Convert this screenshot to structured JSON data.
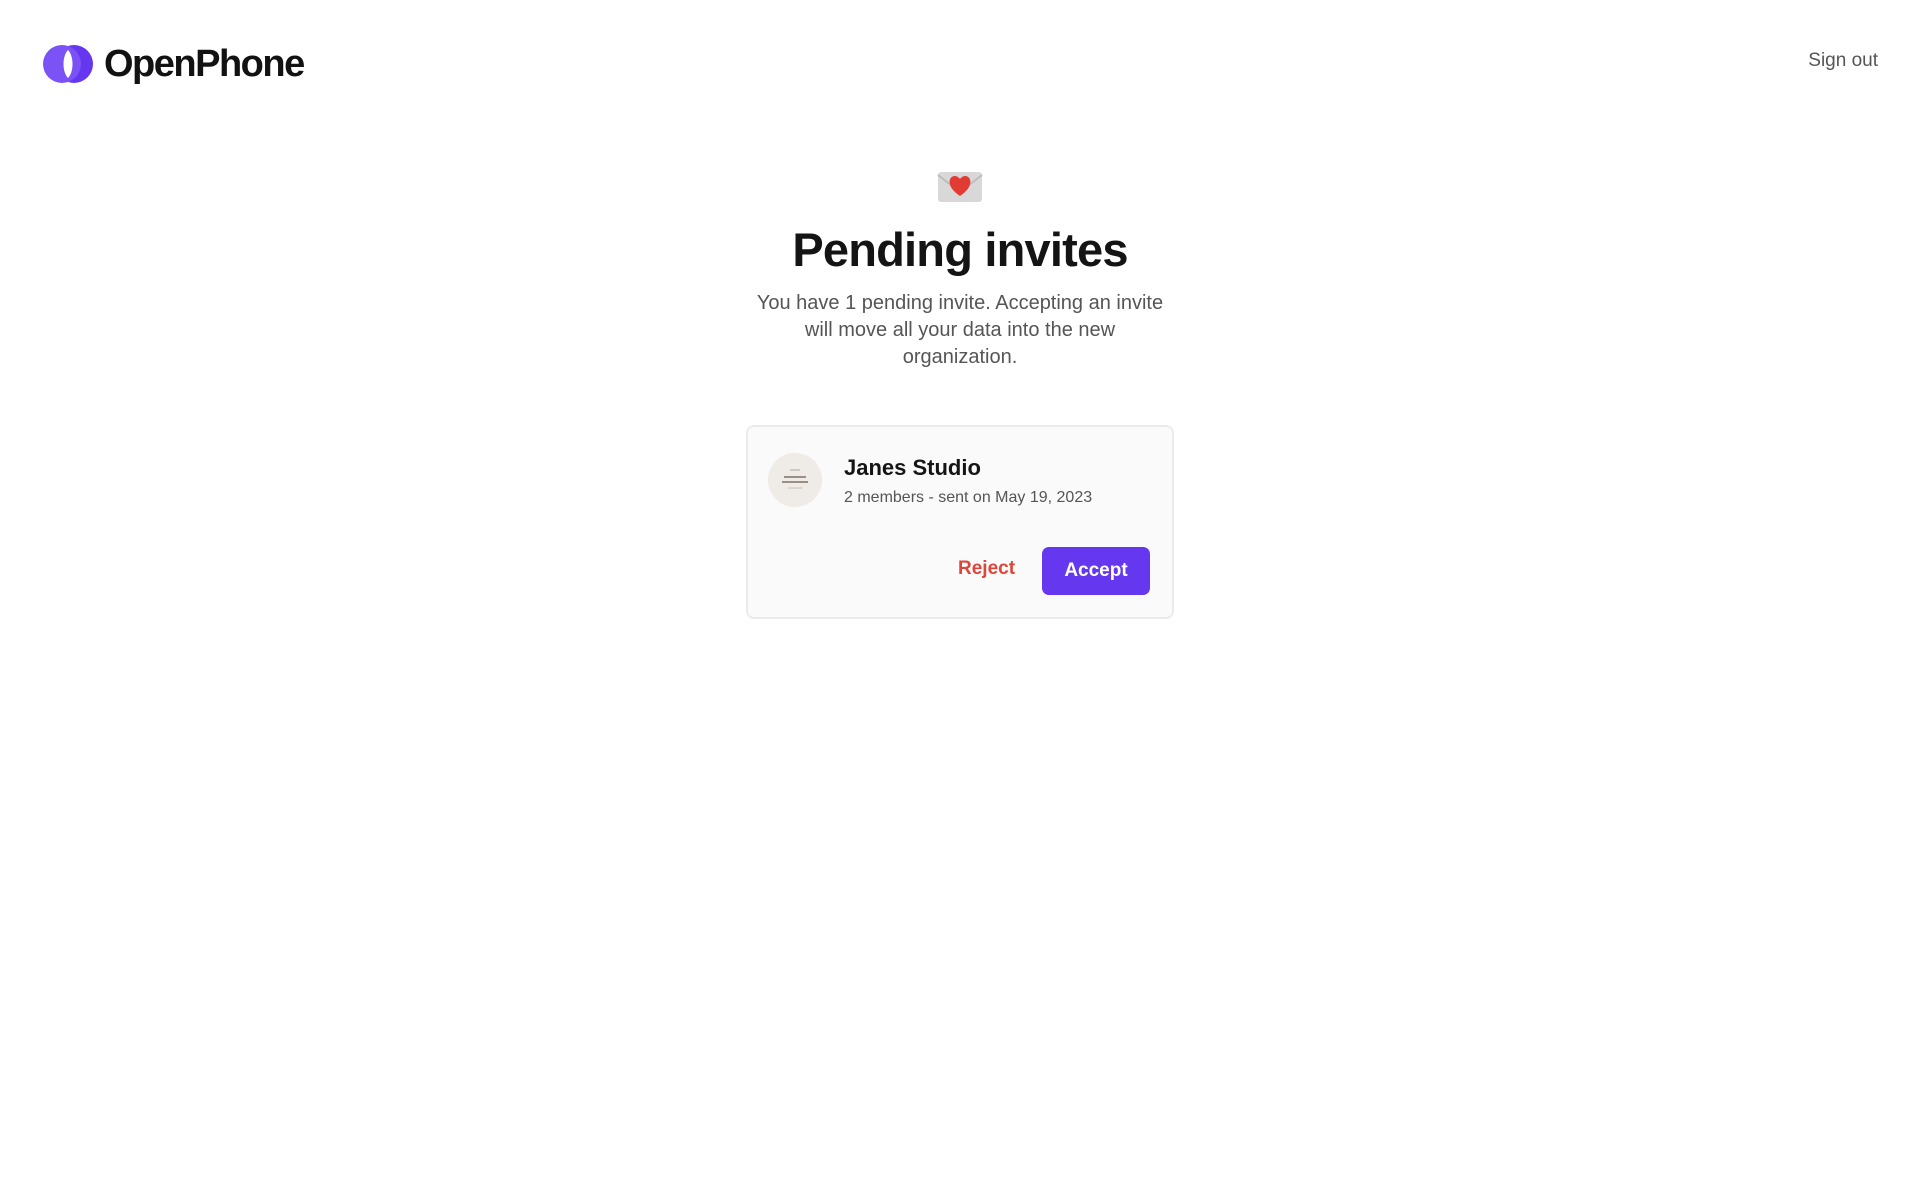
{
  "header": {
    "brand": "OpenPhone",
    "sign_out_label": "Sign out",
    "brand_color": "#6538f0"
  },
  "main": {
    "icon": "love-letter-icon",
    "title": "Pending invites",
    "subtitle": "You have 1 pending invite. Accepting an invite will move all your data into the new organization."
  },
  "invites": [
    {
      "org_name": "Janes Studio",
      "meta": "2 members - sent on May 19, 2023",
      "reject_label": "Reject",
      "accept_label": "Accept",
      "reject_color": "#e0453a",
      "accept_color": "#6538f0"
    }
  ]
}
